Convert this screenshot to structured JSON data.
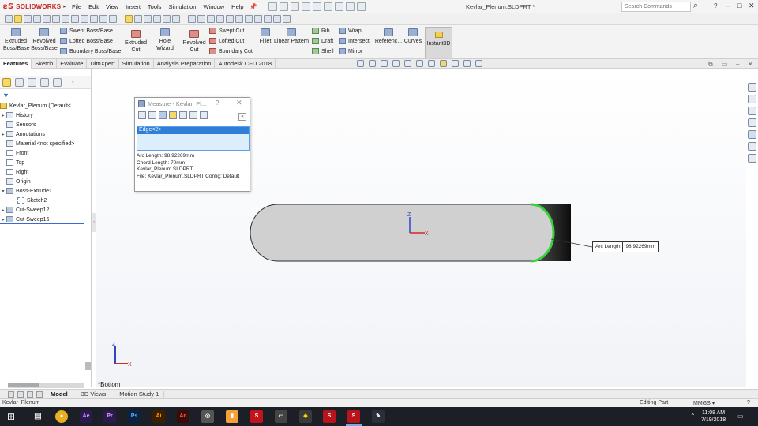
{
  "app": {
    "logo": "SOLIDWORKS",
    "document_title": "Kevlar_Plenum.SLDPRT *",
    "search_placeholder": "Search Commands",
    "help_label": "?",
    "window_controls": [
      "–",
      "□",
      "✕"
    ]
  },
  "menu": [
    "File",
    "Edit",
    "View",
    "Insert",
    "Tools",
    "Simulation",
    "Window",
    "Help"
  ],
  "ribbon": {
    "extruded_boss": [
      "Extruded",
      "Boss/Base"
    ],
    "revolved_boss": [
      "Revolved",
      "Boss/Base"
    ],
    "swept_boss": "Swept Boss/Base",
    "lofted_boss": "Lofted Boss/Base",
    "boundary_boss": "Boundary Boss/Base",
    "extruded_cut": [
      "Extruded",
      "Cut"
    ],
    "hole_wizard": "Hole Wizard",
    "revolved_cut": [
      "Revolved",
      "Cut"
    ],
    "swept_cut": "Swept Cut",
    "lofted_cut": "Lofted Cut",
    "boundary_cut": "Boundary Cut",
    "fillet": "Fillet",
    "linear_pattern": "Linear Pattern",
    "rib": "Rib",
    "draft": "Draft",
    "shell": "Shell",
    "wrap": "Wrap",
    "intersect": "Intersect",
    "mirror": "Mirror",
    "reference": "Referenc...",
    "curves": "Curves",
    "instant3d": "Instant3D"
  },
  "tabs": [
    "Features",
    "Sketch",
    "Evaluate",
    "DimXpert",
    "Simulation",
    "Analysis Preparation",
    "Autodesk CFD 2018"
  ],
  "tree": {
    "root": "Kevlar_Plenum  (Default<",
    "items": [
      {
        "label": "History",
        "exp": "▸",
        "icon": "history-icon"
      },
      {
        "label": "Sensors",
        "exp": "",
        "icon": "sensors-icon"
      },
      {
        "label": "Annotations",
        "exp": "▸",
        "icon": "annotations-icon"
      },
      {
        "label": "Material <not specified>",
        "exp": "",
        "icon": "material-icon"
      },
      {
        "label": "Front",
        "exp": "",
        "icon": "plane-icon"
      },
      {
        "label": "Top",
        "exp": "",
        "icon": "plane-icon"
      },
      {
        "label": "Right",
        "exp": "",
        "icon": "plane-icon"
      },
      {
        "label": "Origin",
        "exp": "",
        "icon": "origin-icon"
      },
      {
        "label": "Boss-Extrude1",
        "exp": "▾",
        "icon": "extrude-icon"
      },
      {
        "label": "Sketch2",
        "exp": "",
        "icon": "sketch-icon"
      },
      {
        "label": "Cut-Sweep12",
        "exp": "▸",
        "icon": "cut-sweep-icon"
      },
      {
        "label": "Cut-Sweep16",
        "exp": "▸",
        "icon": "cut-sweep-icon"
      }
    ]
  },
  "measure": {
    "title": "Measure - Kevlar_Pl...",
    "help": "?",
    "close": "✕",
    "collapse": "«",
    "selection": "Edge<2>",
    "results": [
      "Arc Length: 98.92269mm",
      "Chord Length: 70mm",
      "Kevlar_Plenum.SLDPRT",
      "File: Kevlar_Plenum.SLDPRT Config: Default"
    ]
  },
  "annotation": {
    "label": "Arc Length",
    "value": "98.92269mm"
  },
  "view": {
    "name": "*Bottom",
    "axis_z": "Z",
    "axis_x": "X"
  },
  "bottom_tabs": [
    "Model",
    "3D Views",
    "Motion Study 1"
  ],
  "status": {
    "left": "Kevlar_Plenum",
    "middle": "Editing Part",
    "units": "MMGS",
    "arrow": "▾",
    "help": "?"
  },
  "taskbar": {
    "time": "11:08 AM",
    "date": "7/19/2018",
    "apps": [
      "Ae",
      "Pr",
      "Ps",
      "Ai",
      "An"
    ]
  },
  "colors": {
    "accent": "#2f7ed8",
    "edge_highlight": "#38d13c",
    "part_body": "#cfcfcf"
  }
}
